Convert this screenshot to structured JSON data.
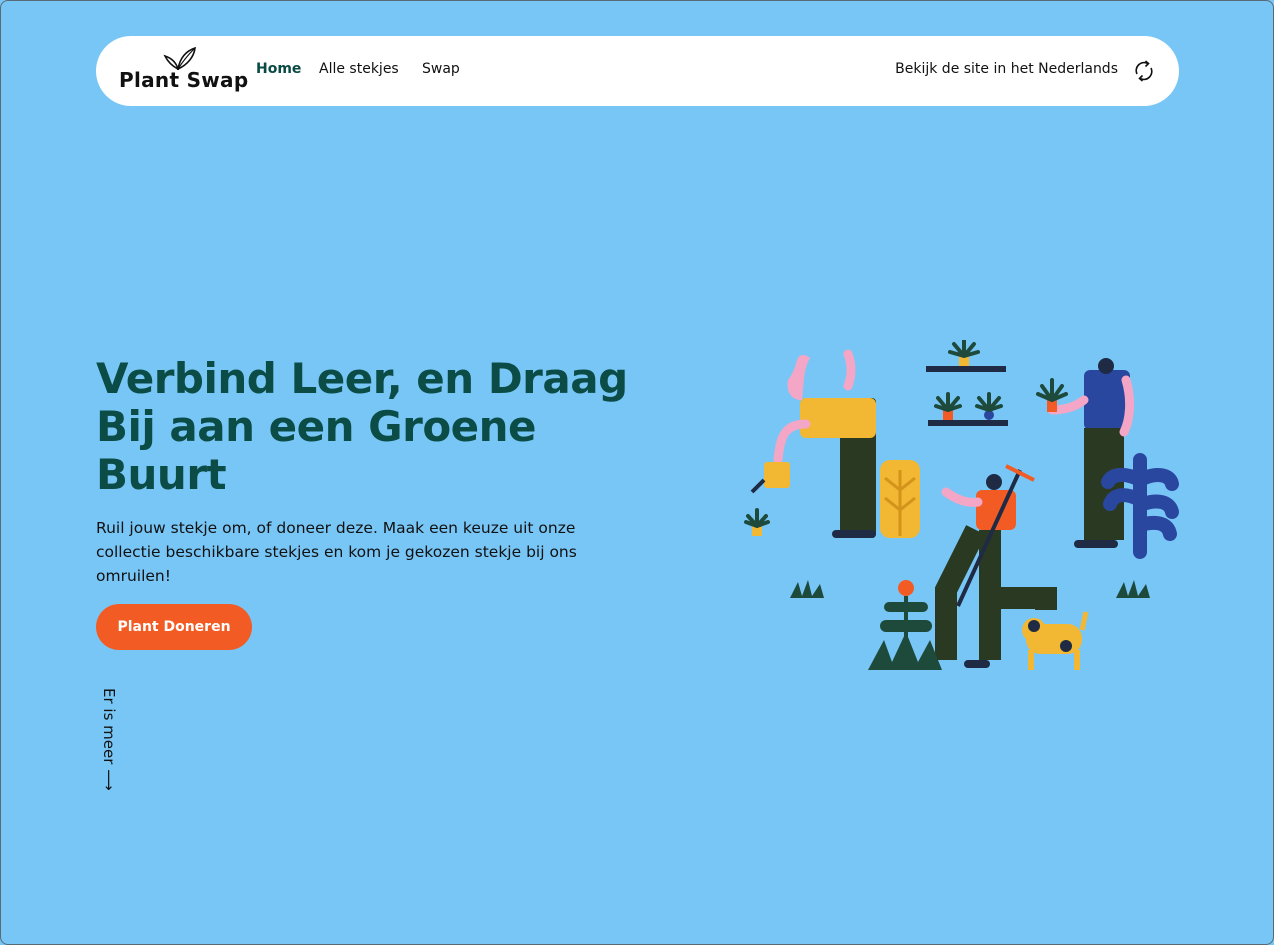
{
  "nav": {
    "logo_text": "Plant Swap",
    "links": [
      {
        "label": "Home",
        "active": true
      },
      {
        "label": "Alle stekjes"
      },
      {
        "label": "Swap"
      }
    ],
    "language_link": "Bekijk de site in het Nederlands",
    "language_icon": "refresh-icon"
  },
  "hero": {
    "title": "Verbind Leer, en Draag Bij aan een Groene Buurt",
    "text": "Ruil jouw stekje om, of doneer deze. Maak een keuze uit onze collectie beschikbare stekjes en kom je gekozen stekje bij ons omruilen!",
    "cta_label": "Plant Doneren",
    "more_label": "Er is meer ⟶"
  },
  "colors": {
    "background": "#78c6f6",
    "title": "#0b4c46",
    "button": "#f25c24",
    "nav_bg": "#ffffff"
  }
}
